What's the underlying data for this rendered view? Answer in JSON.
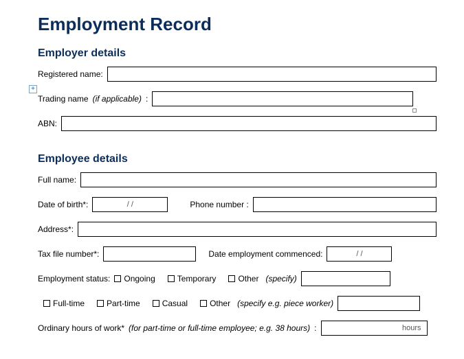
{
  "title": "Employment Record",
  "employer": {
    "heading": "Employer details",
    "registered_name_label": "Registered name:",
    "trading_name_label": "Trading name",
    "trading_name_note": "(if applicable)",
    "trading_name_colon": ":",
    "abn_label": "ABN:"
  },
  "employee": {
    "heading": "Employee details",
    "full_name_label": "Full name:",
    "dob_label": "Date of birth*:",
    "dob_placeholder": "/        /",
    "phone_label": "Phone number  :",
    "address_label": "Address*:",
    "tfn_label": "Tax file number*:",
    "date_commenced_label": "Date employment commenced:",
    "date_commenced_placeholder": "/        /",
    "status_label": "Employment status:",
    "status_ongoing": "Ongoing",
    "status_temporary": "Temporary",
    "status_other": "Other",
    "status_other_note": "(specify)",
    "type_fulltime": "Full-time",
    "type_parttime": "Part-time",
    "type_casual": "Casual",
    "type_other": "Other",
    "type_other_note": "(specify e.g. piece worker)",
    "hours_label": "Ordinary hours of work*",
    "hours_note": "(for part-time or full-time employee; e.g. 38 hours)",
    "hours_colon": ":",
    "hours_unit": "hours"
  }
}
